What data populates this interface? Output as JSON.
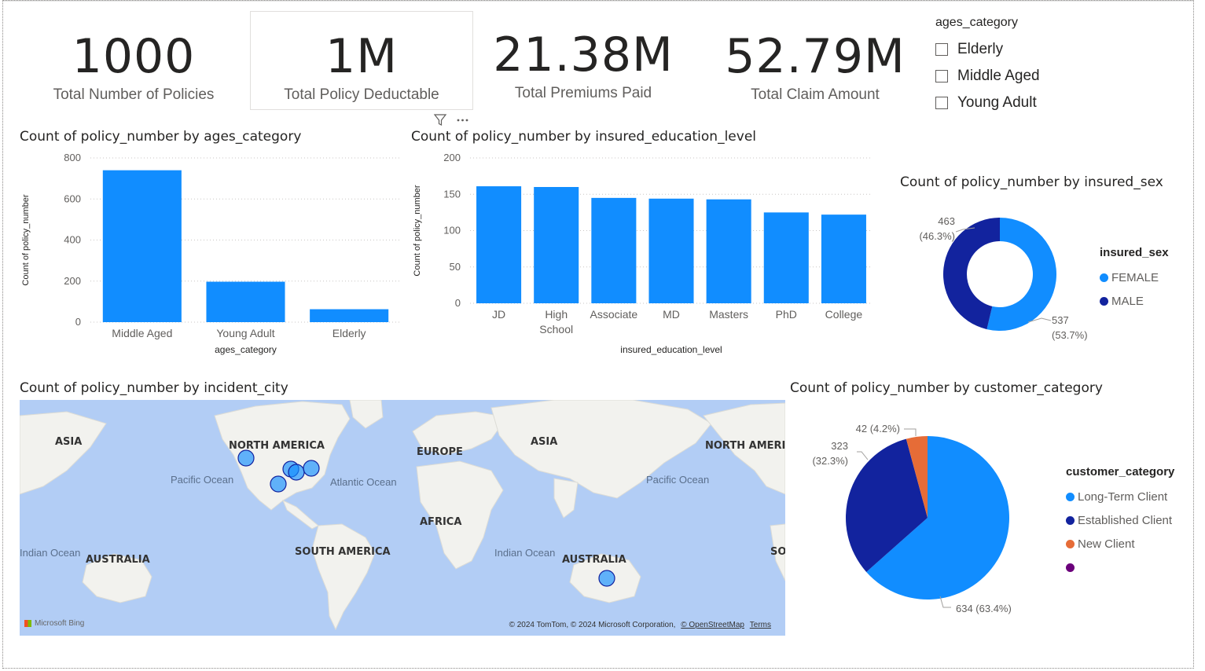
{
  "kpis": [
    {
      "value": "1000",
      "label": "Total Number of Policies"
    },
    {
      "value": "1M",
      "label": "Total Policy Deductable"
    },
    {
      "value": "21.38M",
      "label": "Total Premiums Paid"
    },
    {
      "value": "52.79M",
      "label": "Total Claim Amount"
    }
  ],
  "slicer": {
    "title": "ages_category",
    "options": [
      "Elderly",
      "Middle Aged",
      "Young Adult"
    ]
  },
  "colors": {
    "primary": "#118dff",
    "dark_blue": "#12239e",
    "orange": "#e66c37",
    "purple": "#6b007b"
  },
  "visual_header_icons": [
    "filter-icon",
    "more-options-icon"
  ],
  "chart_data": [
    {
      "type": "bar",
      "title": "Count of policy_number by ages_category",
      "categories": [
        "Middle Aged",
        "Young Adult",
        "Elderly"
      ],
      "values": [
        740,
        197,
        63
      ],
      "xlabel": "ages_category",
      "ylabel": "Count of policy_number",
      "ylim": [
        0,
        800
      ],
      "yticks": [
        "0",
        "200",
        "400",
        "600",
        "800"
      ],
      "grid": true
    },
    {
      "type": "bar",
      "title": "Count of policy_number by insured_education_level",
      "categories": [
        "JD",
        "High School",
        "Associate",
        "MD",
        "Masters",
        "PhD",
        "College"
      ],
      "values": [
        161,
        160,
        145,
        144,
        143,
        125,
        122
      ],
      "xlabel": "insured_education_level",
      "ylabel": "Count of policy_number",
      "ylim": [
        0,
        200
      ],
      "yticks": [
        "0",
        "50",
        "100",
        "150",
        "200"
      ],
      "grid": true
    },
    {
      "type": "donut",
      "title": "Count of policy_number by insured_sex",
      "legend_title": "insured_sex",
      "legend_position": "right",
      "slices": [
        {
          "name": "FEMALE",
          "value": 537,
          "label": "537",
          "pct": "(53.7%)"
        },
        {
          "name": "MALE",
          "value": 463,
          "label": "463",
          "pct": "(46.3%)"
        }
      ]
    },
    {
      "type": "map",
      "title": "Count of policy_number by incident_city",
      "region_labels": [
        "ASIA",
        "NORTH AMERICA",
        "EUROPE",
        "ASIA",
        "NORTH AMERIC",
        "AFRICA",
        "SOUTH AMERICA",
        "AUSTRALIA",
        "AUSTRALIA",
        "SO"
      ],
      "ocean_labels": [
        "Pacific Ocean",
        "Atlantic Ocean",
        "Pacific Ocean",
        "Indian Ocean",
        "Indian Ocean"
      ],
      "attribution": "© 2024 TomTom, © 2024 Microsoft Corporation,",
      "attribution_links": [
        "© OpenStreetMap",
        "Terms"
      ],
      "brand": "Microsoft Bing"
    },
    {
      "type": "pie",
      "title": "Count of policy_number by customer_category",
      "legend_title": "customer_category",
      "legend_position": "right",
      "slices": [
        {
          "name": "Long-Term Client",
          "value": 634,
          "label": "634 (63.4%)"
        },
        {
          "name": "Established Client",
          "value": 323,
          "label": "323",
          "pct": "(32.3%)"
        },
        {
          "name": "New Client",
          "value": 42,
          "label": "42 (4.2%)"
        },
        {
          "name": "",
          "value": 0
        }
      ]
    }
  ]
}
